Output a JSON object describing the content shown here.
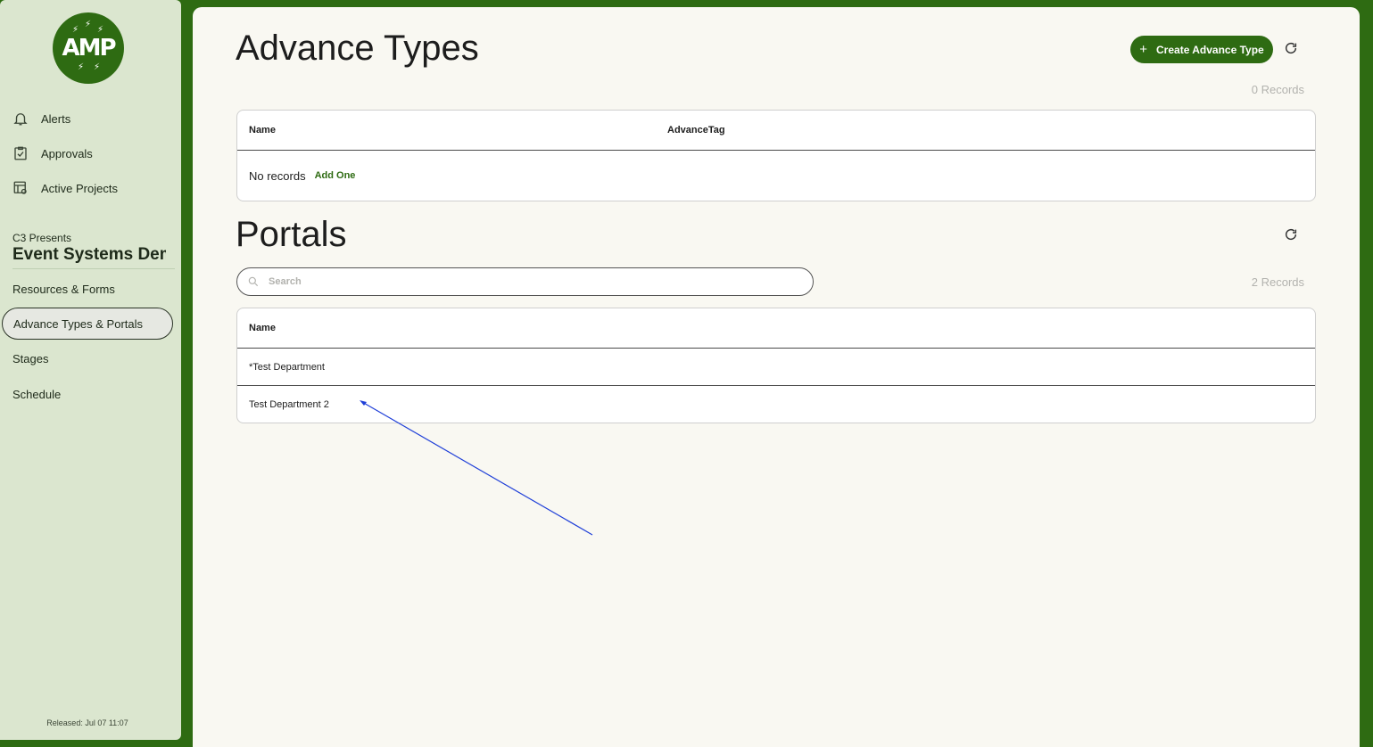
{
  "sidebar": {
    "logo_text": "AMP",
    "nav": [
      {
        "label": "Alerts",
        "icon": "bell-icon"
      },
      {
        "label": "Approvals",
        "icon": "clipboard-check-icon"
      },
      {
        "label": "Active Projects",
        "icon": "projects-icon"
      }
    ],
    "org_subtitle": "C3 Presents",
    "org_title": "Event Systems Demo",
    "project_nav": [
      {
        "label": "Resources & Forms"
      },
      {
        "label": "Advance Types & Portals"
      },
      {
        "label": "Stages"
      },
      {
        "label": "Schedule"
      }
    ],
    "released": "Released: Jul 07 11:07"
  },
  "advance_types": {
    "title": "Advance Types",
    "create_label": "Create Advance Type",
    "records": "0 Records",
    "columns": [
      "Name",
      "AdvanceTag"
    ],
    "empty_text": "No records",
    "add_one": "Add One"
  },
  "portals": {
    "title": "Portals",
    "search_placeholder": "Search",
    "records": "2 Records",
    "columns": [
      "Name"
    ],
    "rows": [
      "*Test Department",
      "Test Department 2"
    ]
  },
  "colors": {
    "brand": "#2e6b12",
    "sidebar": "#dbe6cf",
    "main_bg": "#f9f8f2",
    "annotation_arrow": "#1f3fd8"
  }
}
